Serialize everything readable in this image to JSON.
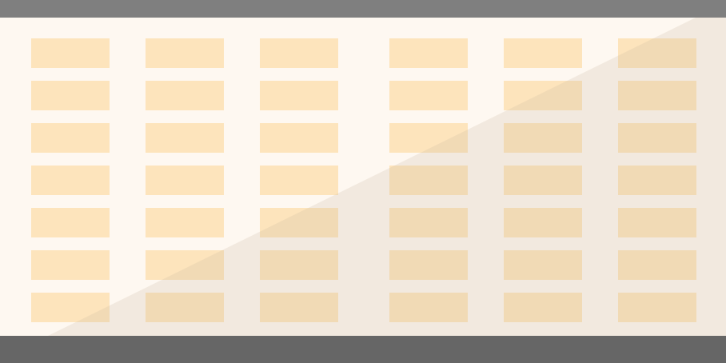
{
  "colors": {
    "top_bar": "#7f7f7f",
    "bottom_bar": "#666666",
    "panel_background": "#fef8f1",
    "tile": "#fde4bc",
    "shadow": "#c8b8a0"
  },
  "grid": {
    "rows": 7,
    "columns": 6
  }
}
